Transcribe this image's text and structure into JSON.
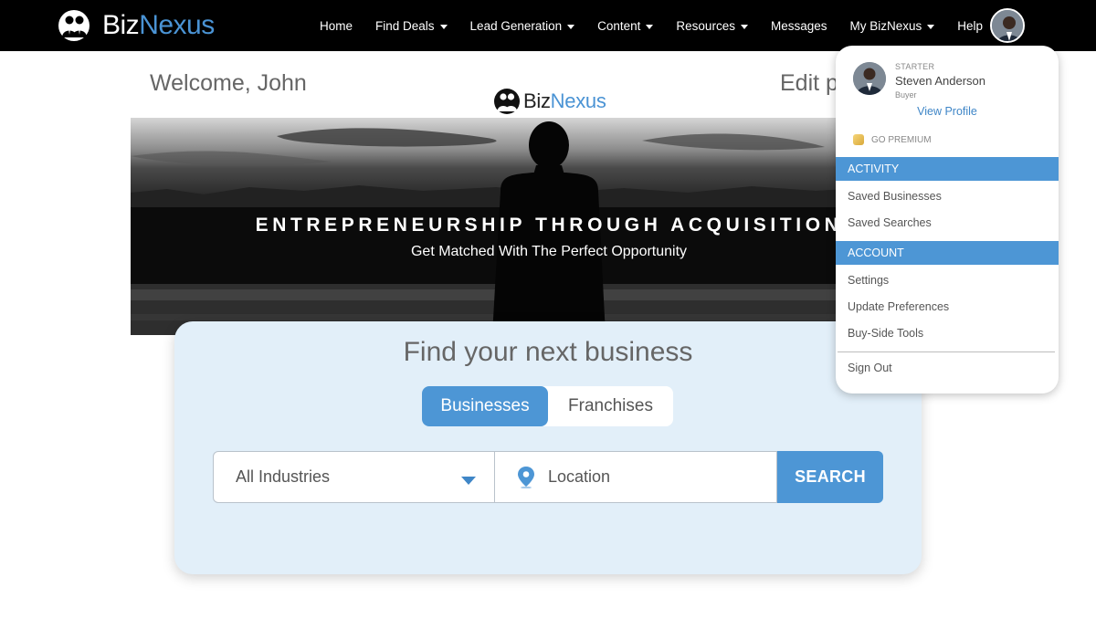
{
  "brand": {
    "name_main": "Biz",
    "name_accent": "Nexus"
  },
  "nav": {
    "items": [
      {
        "label": "Home",
        "has_caret": false
      },
      {
        "label": "Find Deals",
        "has_caret": true
      },
      {
        "label": "Lead Generation",
        "has_caret": true
      },
      {
        "label": "Content",
        "has_caret": true
      },
      {
        "label": "Resources",
        "has_caret": true
      },
      {
        "label": "Messages",
        "has_caret": false
      },
      {
        "label": "My BizNexus",
        "has_caret": true
      },
      {
        "label": "Help",
        "has_caret": false
      }
    ]
  },
  "page": {
    "welcome": "Welcome, John",
    "edit_link": "Edit p"
  },
  "hero": {
    "title": "ENTREPRENEURSHIP THROUGH ACQUISITION",
    "subtitle": "Get Matched With The Perfect Opportunity"
  },
  "search": {
    "heading": "Find your next business",
    "tab_active": "Businesses",
    "tab_inactive": "Franchises",
    "industry_value": "All Industries",
    "location_placeholder": "Location",
    "button": "SEARCH"
  },
  "profile_menu": {
    "plan": "STARTER",
    "name": "Steven Anderson",
    "role": "Buyer",
    "view_profile": "View Profile",
    "premium": "GO PREMIUM",
    "activity_header": "ACTIVITY",
    "activity_items": [
      "Saved Businesses",
      "Saved Searches"
    ],
    "account_header": "ACCOUNT",
    "account_items": [
      "Settings",
      "Update Preferences",
      "Buy-Side Tools"
    ],
    "sign_out": "Sign Out"
  },
  "colors": {
    "accent": "#4d96d5",
    "card_bg": "#e2eff9",
    "topbar": "#000000"
  }
}
